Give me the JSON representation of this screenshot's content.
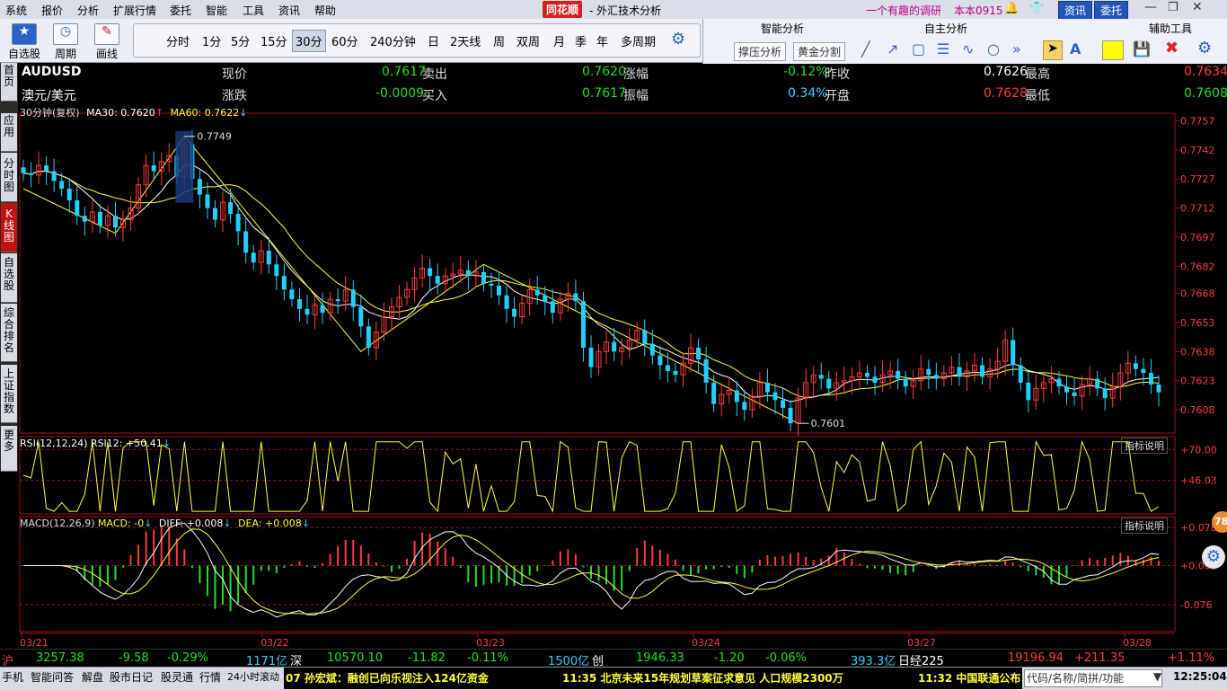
{
  "menu": [
    "系统",
    "报价",
    "分析",
    "扩展行情",
    "委托",
    "智能",
    "工具",
    "资讯",
    "帮助"
  ],
  "app_title": {
    "brand": "同花顺",
    "suffix": "- 外汇技术分析"
  },
  "header_right": {
    "promo": "一个有趣的调研",
    "version": "本本0915",
    "btn_news": "资讯",
    "btn_trade": "委托"
  },
  "toolbar": {
    "self_select": "自选股",
    "period": "周期",
    "draw": "画线"
  },
  "periods": [
    "分时",
    "1分",
    "5分",
    "15分",
    "30分",
    "60分",
    "240分钟",
    "日",
    "2天线",
    "周",
    "双周",
    "月",
    "季",
    "年",
    "多周期"
  ],
  "selected_period": "30分",
  "analysis": {
    "smart": "智能分析",
    "self": "自主分析",
    "aux": "辅助工具",
    "support_btn": "撑压分析",
    "golden_btn": "黄金分割"
  },
  "left_tabs": [
    "首页",
    "应用",
    "分时图",
    "K线图",
    "自选股",
    "综合排名",
    "上证指数",
    "更多"
  ],
  "quote": {
    "symbol": "AUDUSD",
    "name": "澳元/美元",
    "now_label": "现价",
    "now": "0.7617",
    "sell_label": "卖出",
    "sell": "0.7620",
    "pct_label": "涨幅",
    "pct": "-0.12%",
    "prev_label": "昨收",
    "prev": "0.7626",
    "high_label": "最高",
    "high": "0.7634",
    "chg_label": "涨跌",
    "chg": "-0.0009",
    "buy_label": "买入",
    "buy": "0.7617",
    "amp_label": "振幅",
    "amp": "0.34%",
    "open_label": "开盘",
    "open": "0.7628",
    "low_label": "最低",
    "low": "0.7608"
  },
  "main_legend": {
    "period": "30分钟(复权)",
    "ma30": "MA30: 0.7620",
    "ma60": "MA60: 0.7622"
  },
  "rsi_legend": "RSI(12,12,24) RSI12: +50.41",
  "macd_legend": {
    "name": "MACD(12,26,9)",
    "macd": "MACD: -0",
    "diff": "DIFF: +0.008",
    "dea": "DEA: +0.008"
  },
  "indicator_btn": "指标说明",
  "colors": {
    "up": "#ff3b3b",
    "down": "#22d0ff",
    "ma30": "#ffffff",
    "ma60": "#ffff33",
    "bg": "#000000"
  },
  "chart_data": [
    {
      "type": "candlestick",
      "title": "AUDUSD 30分",
      "y_ticks": [
        "0.7757",
        "0.7742",
        "0.7727",
        "0.7712",
        "0.7697",
        "0.7682",
        "0.7668",
        "0.7653",
        "0.7638",
        "0.7623",
        "0.7608"
      ],
      "ylim": [
        0.7596,
        0.776
      ],
      "x_ticks": [
        "03/21",
        "03/22",
        "03/23",
        "03/24",
        "03/27",
        "03/28"
      ],
      "annotations": [
        {
          "label": "0.7749",
          "value": 0.7749
        },
        {
          "label": "0.7601",
          "value": 0.7601
        }
      ],
      "series": [
        {
          "name": "MA30"
        },
        {
          "name": "MA60"
        }
      ],
      "close_path": [
        0.773,
        0.7729,
        0.7734,
        0.7731,
        0.7726,
        0.7722,
        0.7716,
        0.7708,
        0.7705,
        0.771,
        0.7703,
        0.7708,
        0.7702,
        0.7706,
        0.7712,
        0.7724,
        0.7734,
        0.7731,
        0.7736,
        0.7739,
        0.7728,
        0.7745,
        0.7727,
        0.7719,
        0.7712,
        0.7706,
        0.7715,
        0.7709,
        0.77,
        0.7689,
        0.7684,
        0.769,
        0.7683,
        0.7677,
        0.767,
        0.7665,
        0.766,
        0.7657,
        0.7662,
        0.7658,
        0.7665,
        0.7664,
        0.767,
        0.7661,
        0.7651,
        0.764,
        0.7648,
        0.7656,
        0.7661,
        0.7666,
        0.767,
        0.7676,
        0.7681,
        0.7677,
        0.7673,
        0.7677,
        0.7678,
        0.768,
        0.7677,
        0.7679,
        0.7673,
        0.7672,
        0.7667,
        0.766,
        0.7656,
        0.7663,
        0.767,
        0.7667,
        0.7664,
        0.7658,
        0.7665,
        0.7668,
        0.7664,
        0.764,
        0.763,
        0.7638,
        0.7643,
        0.7638,
        0.764,
        0.7644,
        0.7649,
        0.7642,
        0.7636,
        0.7631,
        0.7628,
        0.7626,
        0.7632,
        0.764,
        0.7634,
        0.7622,
        0.7611,
        0.7616,
        0.7618,
        0.7612,
        0.7608,
        0.7615,
        0.7622,
        0.7617,
        0.7613,
        0.7609,
        0.7601,
        0.7614,
        0.7622,
        0.7626,
        0.7624,
        0.7619,
        0.7622,
        0.7623,
        0.7625,
        0.7627,
        0.7625,
        0.7622,
        0.7626,
        0.7628,
        0.7624,
        0.762,
        0.7623,
        0.7629,
        0.7626,
        0.7624,
        0.7627,
        0.763,
        0.7625,
        0.7628,
        0.7631,
        0.7625,
        0.7629,
        0.7633,
        0.7644,
        0.7631,
        0.7622,
        0.7613,
        0.7619,
        0.7622,
        0.7624,
        0.762,
        0.7617,
        0.7615,
        0.7621,
        0.7624,
        0.7619,
        0.7614,
        0.762,
        0.7627,
        0.7632,
        0.7629,
        0.7627,
        0.7621,
        0.7617
      ]
    },
    {
      "type": "line",
      "title": "RSI(12,12,24)",
      "y_ticks": [
        "+70.00",
        "+46.03"
      ],
      "ylim": [
        20,
        80
      ]
    },
    {
      "type": "bar",
      "title": "MACD(12,26,9)",
      "y_ticks": [
        "+0.078",
        "+0.002",
        "-0.076"
      ],
      "ylim": [
        -0.13,
        0.1
      ]
    }
  ],
  "status": {
    "sh_label": "沪",
    "sh_val": "3257.38",
    "sh_chg": "-9.58",
    "sh_pct": "-0.29%",
    "sh_amt": "1171亿",
    "sz_label": "深",
    "sz_val": "10570.10",
    "sz_chg": "-11.82",
    "sz_pct": "-0.11%",
    "sz_amt": "1500亿",
    "cy_label": "创",
    "cy_val": "1946.33",
    "cy_chg": "-1.20",
    "cy_pct": "-0.06%",
    "cy_amt": "393.3亿",
    "rj_label": "日经225",
    "rj_val": "19196.94",
    "rj_chg": "+211.35",
    "rj_pct": "+1.11%"
  },
  "bottom": {
    "items": [
      "手机",
      "智能问答",
      "解盘",
      "股市日记",
      "股灵通",
      "行情",
      "24小时滚动"
    ],
    "news1": "07 孙宏斌：融创已向乐视注入124亿资金",
    "news2": "11:35 北京未来15年规划草案征求意见 人口规模2300万",
    "news3": "11:32 中国联通公布",
    "search": "代码/名称/简拼/功能",
    "time": "12:25:04"
  },
  "badge": "78"
}
